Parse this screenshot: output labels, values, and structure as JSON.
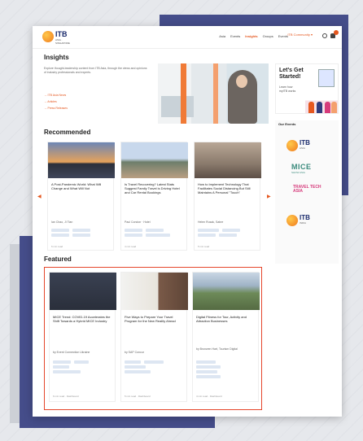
{
  "nav": {
    "logo_text": "ITB",
    "logo_sub": "ASIA · SINGAPORE",
    "links": [
      {
        "label": "Asia",
        "active": false
      },
      {
        "label": "Events",
        "active": false
      },
      {
        "label": "Insights",
        "active": true
      },
      {
        "label": "Groups",
        "active": false
      },
      {
        "label": "Events",
        "active": false
      }
    ],
    "cta_label": "ITB Community ▾",
    "cta_extra": "★ ▾",
    "search_icon": "search-icon",
    "bell_icon": "bell-icon",
    "badge_color": "#e5571f"
  },
  "insights": {
    "title": "Insights",
    "intro": "Explore thought-leadership content from ITB Asia, through the views and opinions of industry professionals and experts.",
    "links": [
      "ITB Asia News",
      "Articles",
      "Press Releases"
    ]
  },
  "ad": {
    "title": "Let's Get Started!",
    "subtitle": "Learn how",
    "subtitle2": "myITB works"
  },
  "events": {
    "title": "Our Events",
    "items": [
      {
        "kind": "itb",
        "name": "ITB",
        "sub": "ASIA"
      },
      {
        "kind": "mice",
        "name": "MICE",
        "sub": "SHOW ASIA"
      },
      {
        "kind": "tech",
        "name": "TRAVEL TECH ASIA",
        "sub": ""
      },
      {
        "kind": "itb",
        "name": "ITB",
        "sub": "INDIA"
      }
    ]
  },
  "recommended": {
    "title": "Recommended",
    "cards": [
      {
        "title": "A Post-Pandemic World: What Will Change and What Will Not",
        "author": "Ian Chao, Ji Tian",
        "meta": "6 min read"
      },
      {
        "title": "Is Travel Recovering? Latest Stats Suggest Family Travel is Driving Hotel and Car Rental Bookings",
        "author": "Paul Condon · Hotel",
        "meta": "4 min read"
      },
      {
        "title": "How to Implement Technology That Facilitates Social Distancing But Still Maintains A Personal \"Touch\"",
        "author": "Helen Rusak, Sabre",
        "meta": "5 min read"
      }
    ]
  },
  "featured": {
    "title": "Featured",
    "cards": [
      {
        "title": "MICE Trend: COVID-19 Accelerates the Shift Towards a Hybrid MICE Industry",
        "author": "by Event Connection Ukraine",
        "meta": "6 min read · Dashboard"
      },
      {
        "title": "Five Ways to Prepare Your Travel Program for the New Reality Ahead",
        "author": "by SAP Concur",
        "meta": "5 min read · Dashboard"
      },
      {
        "title": "Digital Fitness for Tour, Activity and Attraction Businesses",
        "author": "by Bronwen Hart, Tourism Digital",
        "meta": "4 min read · Dashboard"
      }
    ]
  }
}
